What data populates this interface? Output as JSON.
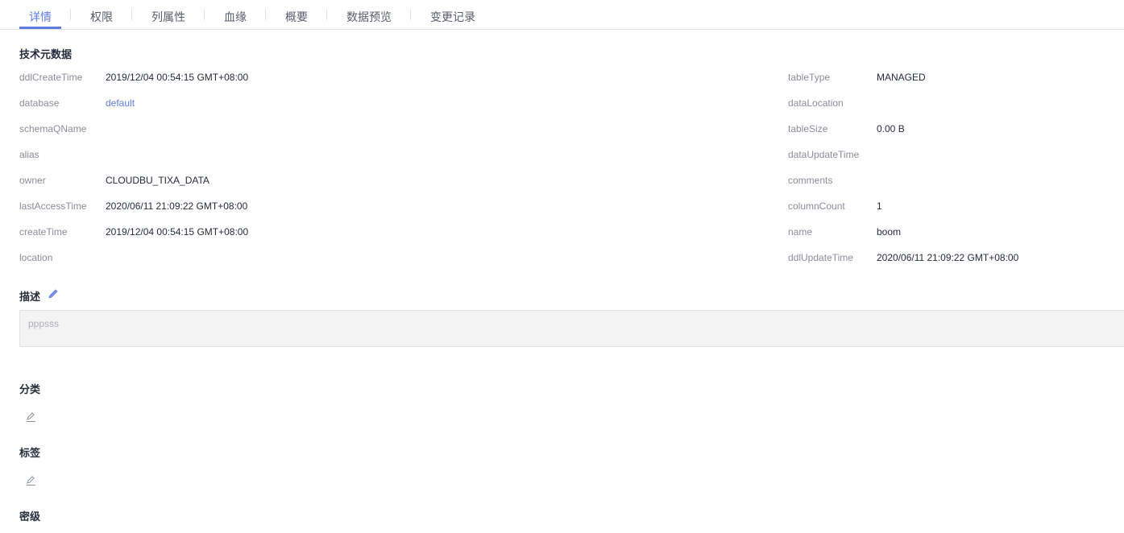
{
  "tabs": [
    "详情",
    "权限",
    "列属性",
    "血缘",
    "概要",
    "数据预览",
    "变更记录"
  ],
  "sections": {
    "tech": "技术元数据",
    "desc": "描述",
    "category": "分类",
    "tags": "标签",
    "secret": "密级"
  },
  "left": [
    {
      "label": "ddlCreateTime",
      "value": "2019/12/04 00:54:15 GMT+08:00"
    },
    {
      "label": "database",
      "value": "default"
    },
    {
      "label": "schemaQName",
      "value": ""
    },
    {
      "label": "alias",
      "value": ""
    },
    {
      "label": "owner",
      "value": "CLOUDBU_TIXA_DATA"
    },
    {
      "label": "lastAccessTime",
      "value": "2020/06/11 21:09:22 GMT+08:00"
    },
    {
      "label": "createTime",
      "value": "2019/12/04 00:54:15 GMT+08:00"
    },
    {
      "label": "location",
      "value": ""
    }
  ],
  "right": [
    {
      "label": "tableType",
      "value": "MANAGED"
    },
    {
      "label": "dataLocation",
      "value": ""
    },
    {
      "label": "tableSize",
      "value": "0.00 B"
    },
    {
      "label": "dataUpdateTime",
      "value": ""
    },
    {
      "label": "comments",
      "value": ""
    },
    {
      "label": "columnCount",
      "value": "1"
    },
    {
      "label": "name",
      "value": "boom"
    },
    {
      "label": "ddlUpdateTime",
      "value": "2020/06/11 21:09:22 GMT+08:00"
    }
  ],
  "description": "pppsss"
}
